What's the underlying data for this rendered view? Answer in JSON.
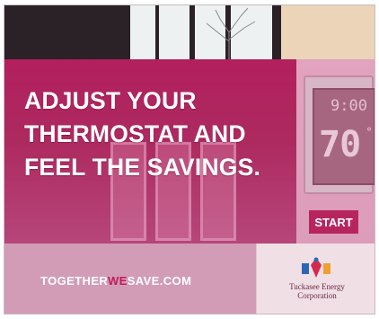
{
  "headline": {
    "line1": "ADJUST YOUR",
    "line2": "THERMOSTAT AND",
    "line3": "FEEL THE SAVINGS."
  },
  "thermostat": {
    "time": "9:00",
    "temperature": "70",
    "degree_symbol": "°"
  },
  "cta": {
    "label": "START"
  },
  "footer": {
    "url_part1": "TOGETHER",
    "url_part2": "WE",
    "url_part3": "SAVE.COM"
  },
  "logo": {
    "line1": "Tuckasee Energy",
    "line2": "Corporation"
  },
  "colors": {
    "brand_magenta": "#b21f5e",
    "panel_pink": "#d6a1bb",
    "white": "#ffffff"
  }
}
